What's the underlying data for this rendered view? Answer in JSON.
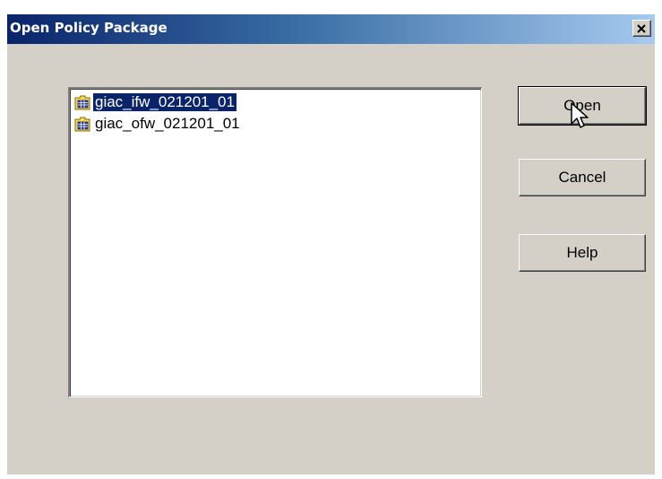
{
  "window": {
    "title": "Open Policy Package"
  },
  "list": {
    "items": [
      {
        "label": "giac_ifw_021201_01",
        "icon": "policy-folder-icon",
        "selected": true
      },
      {
        "label": "giac_ofw_021201_01",
        "icon": "policy-folder-icon",
        "selected": false
      }
    ]
  },
  "buttons": {
    "open_label": "Open",
    "cancel_label": "Cancel",
    "help_label": "Help"
  },
  "colors": {
    "selection": "#0a246a",
    "dialog_bg": "#d4d0c8",
    "title_start": "#0a246a",
    "title_end": "#a6caf0"
  }
}
